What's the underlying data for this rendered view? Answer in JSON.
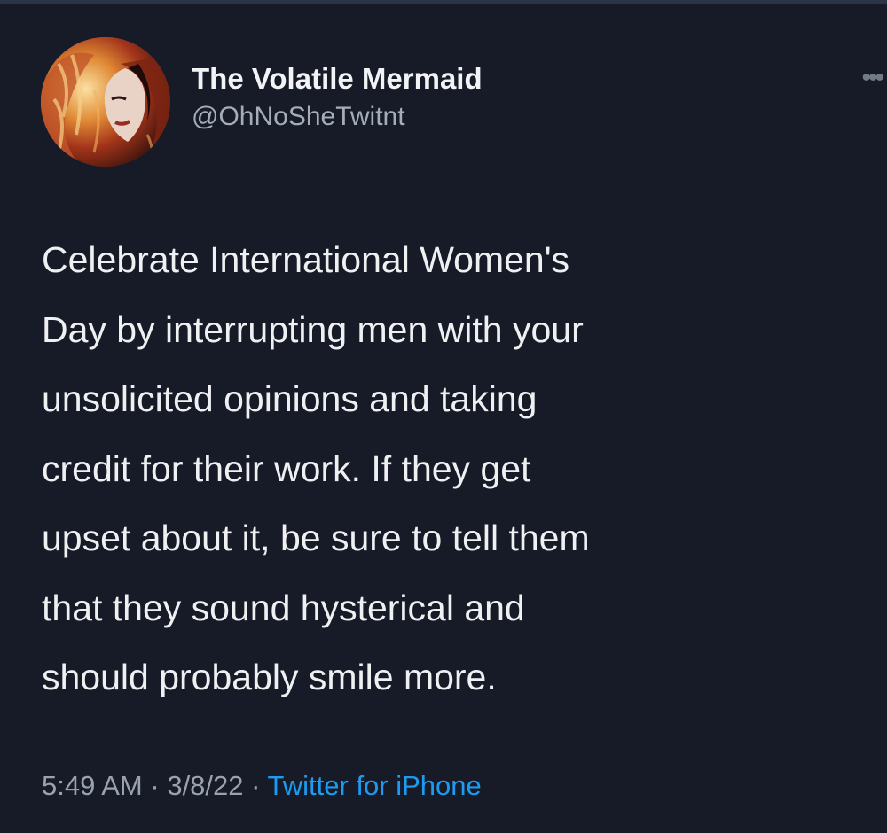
{
  "tweet": {
    "author": {
      "display_name": "The Volatile Mermaid",
      "handle": "@OhNoSheTwitnt",
      "avatar_icon": "avatar-portrait"
    },
    "more_icon": "more-options-icon",
    "text_lines": [
      "Celebrate International Women's",
      "Day by interrupting men with your",
      "unsolicited opinions and taking",
      "credit for their work. If they get",
      "upset about it, be sure to tell them",
      "that they sound hysterical and",
      "should probably smile more."
    ],
    "meta": {
      "time": "5:49 AM",
      "separator": "·",
      "date": "3/8/22",
      "source": "Twitter for iPhone"
    }
  },
  "colors": {
    "background": "#171a27",
    "text": "#eef0f2",
    "secondary": "#9aa3ad",
    "link": "#1d9bf0"
  }
}
